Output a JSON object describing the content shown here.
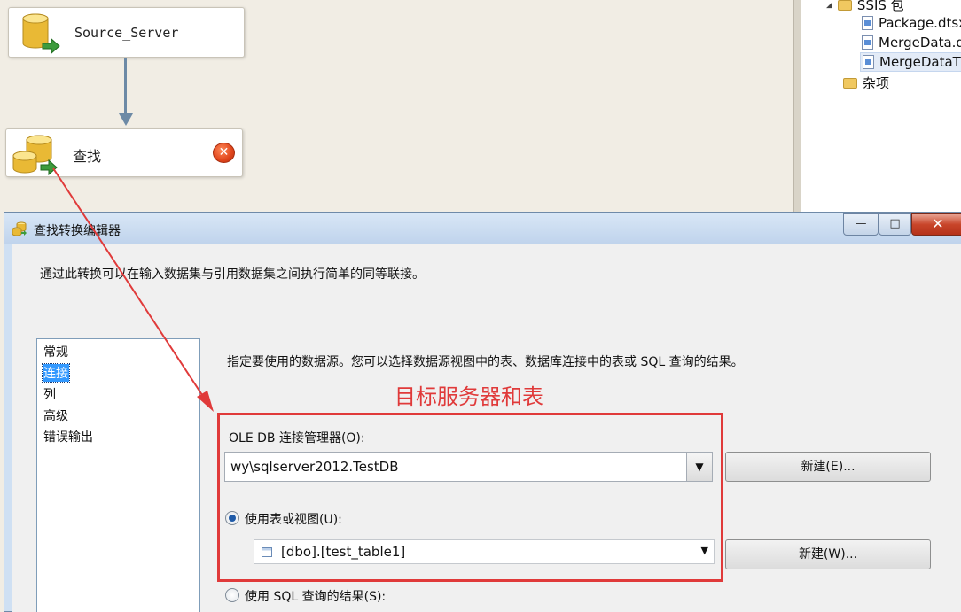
{
  "canvas": {
    "source_task": {
      "label": "Source_Server"
    },
    "lookup_task": {
      "label": "查找"
    }
  },
  "explorer": {
    "items": [
      {
        "label": "SSIS 包",
        "icon": "folder-icon",
        "expanded": true
      },
      {
        "label": "Package.dtsx",
        "icon": "package-file-icon"
      },
      {
        "label": "MergeData.d",
        "icon": "package-file-icon"
      },
      {
        "label": "MergeDataT",
        "icon": "package-file-icon",
        "selected": true
      },
      {
        "label": "杂项",
        "icon": "folder-icon"
      }
    ]
  },
  "dialog": {
    "title": "查找转换编辑器",
    "window_buttons": {
      "minimize": "—",
      "maximize": "□",
      "close": "✕"
    },
    "description": "通过此转换可以在输入数据集与引用数据集之间执行简单的同等联接。",
    "nav": {
      "items": [
        "常规",
        "连接",
        "列",
        "高级",
        "错误输出"
      ],
      "selected": "连接"
    },
    "page_description": "指定要使用的数据源。您可以选择数据源视图中的表、数据库连接中的表或 SQL 查询的结果。",
    "annotation": "目标服务器和表",
    "connection_manager": {
      "label": "OLE DB 连接管理器(O):",
      "value": "wy\\sqlserver2012.TestDB",
      "new_button": "新建(E)..."
    },
    "use_table": {
      "label": "使用表或视图(U):",
      "checked": true,
      "value": "[dbo].[test_table1]",
      "new_button": "新建(W)..."
    },
    "use_sql": {
      "label": "使用 SQL 查询的结果(S):",
      "checked": false
    }
  },
  "colors": {
    "annotation_red": "#e03a3a",
    "selection_blue": "#3399ff",
    "connector": "#6d8aa6"
  }
}
